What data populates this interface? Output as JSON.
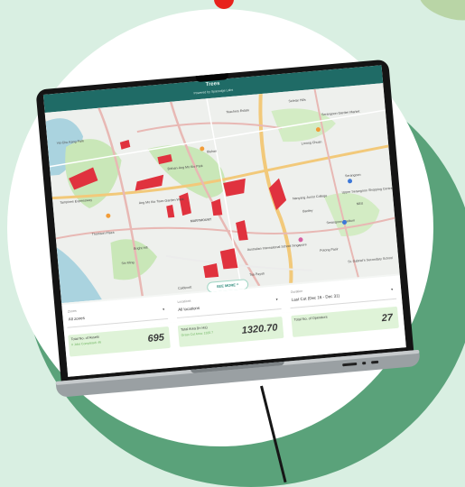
{
  "app": {
    "title": "Trees",
    "powered_by": "Powered by Spacedge Labs"
  },
  "map": {
    "labels": [
      "Yio Chu Kang Park",
      "Teachers Estate",
      "Seletar Hills",
      "Tampines Expressway",
      "Serangoon Garden Market",
      "Ang Mo Kio Town Garden West",
      "Bishan-Ang Mo Kio Park",
      "Bishan",
      "Lorong Chuan",
      "Serangoon",
      "MARYMOUNT",
      "Thomson Plaza",
      "Nanyang Junior College",
      "Bartley",
      "Australian International School Singapore",
      "Bright Hill",
      "Sin Ming",
      "Toa Payoh",
      "Serangoon Stadium",
      "Upper Serangoon Shopping Centre",
      "NEX",
      "Potong Pasir",
      "St. Gabriel's Secondary School",
      "Caldecott"
    ],
    "see_more_label": "SEE MORE ^",
    "colors": {
      "land": "#eef0ed",
      "park": "#c9e7b8",
      "water": "#aad3df",
      "road_major": "#e8b8b4",
      "road_highway": "#f2c97a",
      "felled_zone": "#e0323e"
    }
  },
  "filters": [
    {
      "label": "Zones",
      "value": "All zones"
    },
    {
      "label": "Locations",
      "value": "All locations"
    },
    {
      "label": "Duration",
      "value": "Last Cut (Dec 16 - Dec 31)"
    }
  ],
  "cards": [
    {
      "label": "Total No. of Assets",
      "sub": "# Jobs Completed: 46",
      "value": "695"
    },
    {
      "label": "Total Area (In Ha)",
      "sub": "Grass Cut Area: 1320.7",
      "value": "1320.70"
    },
    {
      "label": "Total No. of Operators",
      "sub": "",
      "value": "27"
    }
  ],
  "colors": {
    "header": "#1f6b66",
    "card_bg": "#dff3d8",
    "background": "#d9efe2",
    "accent_circle": "#5aa27a",
    "dot": "#e8221b"
  }
}
